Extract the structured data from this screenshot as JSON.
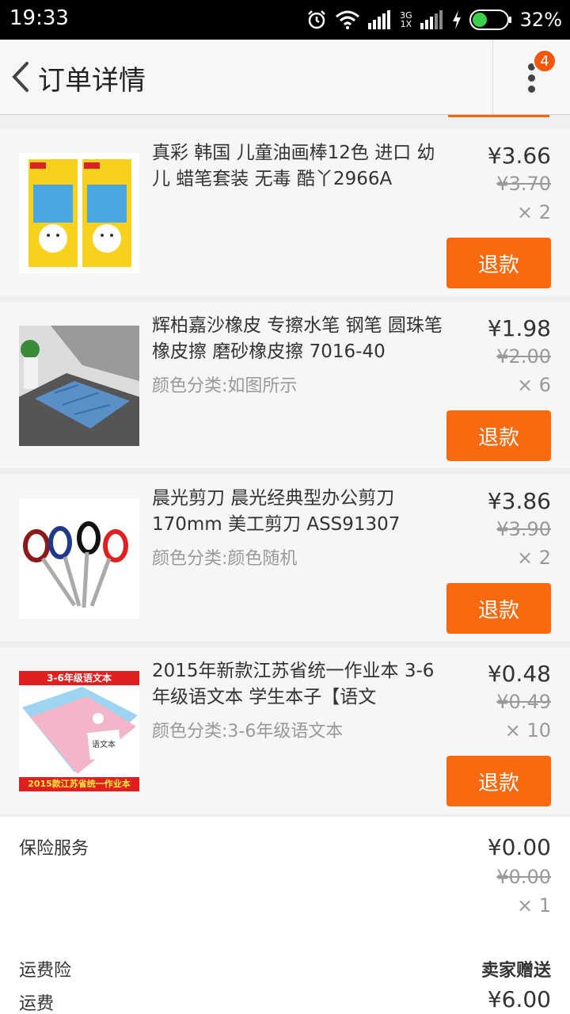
{
  "status_bar": {
    "time": "19:33",
    "network_top": "3G",
    "network_bottom": "1X",
    "battery": "32%"
  },
  "header": {
    "title": "订单详情",
    "badge_count": "4"
  },
  "items": [
    {
      "name": "真彩 韩国 儿童油画棒12色 进口 幼儿 蜡笔套装 无毒 酷丫2966A",
      "sku": "",
      "price": "¥3.66",
      "original_price": "¥3.70",
      "quantity": "× 2",
      "refund_label": "退款"
    },
    {
      "name": "辉柏嘉沙橡皮 专擦水笔 钢笔 圆珠笔橡皮擦 磨砂橡皮擦 7016-40",
      "sku": "颜色分类:如图所示",
      "price": "¥1.98",
      "original_price": "¥2.00",
      "quantity": "× 6",
      "refund_label": "退款"
    },
    {
      "name": "晨光剪刀 晨光经典型办公剪刀170mm 美工剪刀 ASS91307",
      "sku": "颜色分类:颜色随机",
      "price": "¥3.86",
      "original_price": "¥3.90",
      "quantity": "× 2",
      "refund_label": "退款"
    },
    {
      "name": "2015年新款江苏省统一作业本 3-6年级语文本 学生本子【语文",
      "sku": "颜色分类:3-6年级语文本",
      "price": "¥0.48",
      "original_price": "¥0.49",
      "quantity": "× 10",
      "refund_label": "退款"
    }
  ],
  "item_images": {
    "notebook_banner_top": "3-6年级语文本",
    "notebook_banner_bottom": "2015款江苏省统一作业本",
    "notebook_cover": "语文本"
  },
  "insurance": {
    "label": "保险服务",
    "price": "¥0.00",
    "original_price": "¥0.00",
    "quantity": "× 1"
  },
  "shipping_insurance": {
    "label": "运费险",
    "value": "卖家赠送"
  },
  "shipping": {
    "label": "运费",
    "value": "¥6.00"
  },
  "colors": {
    "accent": "#f9690e",
    "badge": "#f5560a"
  }
}
